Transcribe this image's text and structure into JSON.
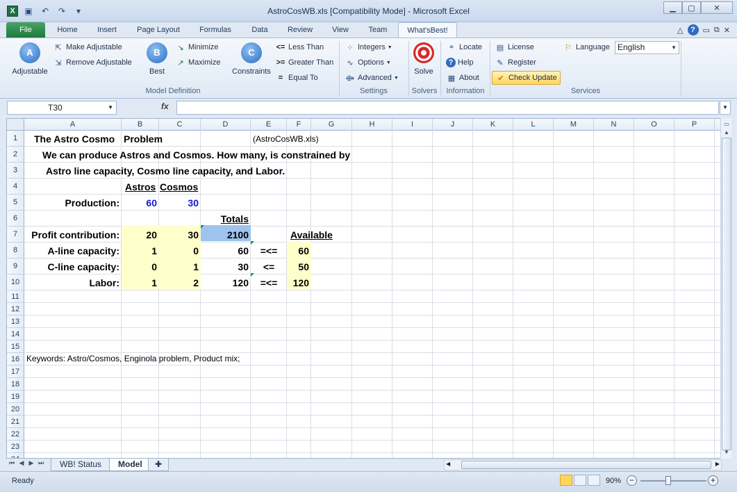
{
  "window": {
    "title": "AstroCosWB.xls  [Compatibility Mode]  -  Microsoft Excel",
    "app_icon": "X"
  },
  "ribbon_tabs": {
    "file": "File",
    "items": [
      "Home",
      "Insert",
      "Page Layout",
      "Formulas",
      "Data",
      "Review",
      "View",
      "Team",
      "What'sBest!"
    ]
  },
  "ribbon": {
    "adjustable": "Adjustable",
    "adjustable_icon_letter": "A",
    "make_adjustable": "Make Adjustable",
    "remove_adjustable": "Remove Adjustable",
    "best": "Best",
    "best_icon_letter": "B",
    "minimize": "Minimize",
    "maximize": "Maximize",
    "constraints": "Constraints",
    "constraints_icon_letter": "C",
    "less_than": "Less Than",
    "greater_than": "Greater Than",
    "equal_to": "Equal To",
    "integers": "Integers",
    "options": "Options",
    "advanced": "Advanced",
    "solve": "Solve",
    "locate": "Locate",
    "help": "Help",
    "about": "About",
    "license": "License",
    "register": "Register",
    "check_update": "Check Update",
    "language_label": "Language",
    "language_value": "English",
    "groups": {
      "model_definition": "Model Definition",
      "settings": "Settings",
      "solvers": "Solvers",
      "information": "Information",
      "services": "Services"
    }
  },
  "formula_bar": {
    "name_box": "T30",
    "fx": "fx",
    "formula": ""
  },
  "sheet": {
    "columns": [
      "A",
      "B",
      "C",
      "D",
      "E",
      "F",
      "G",
      "H",
      "I",
      "J",
      "K",
      "L",
      "M",
      "N",
      "O",
      "P"
    ],
    "rows": [
      "1",
      "2",
      "3",
      "4",
      "5",
      "6",
      "7",
      "8",
      "9",
      "10",
      "11",
      "12",
      "13",
      "14",
      "15",
      "16",
      "17",
      "18",
      "19",
      "20",
      "21",
      "22",
      "23",
      "24"
    ],
    "cells": {
      "A1": "The Astro Cosmo",
      "B1": "Problem",
      "E1": "(AstroCosWB.xls)",
      "A2": "We can produce Astros and Cosmos.  How many, is constrained by",
      "A3": "Astro line capacity, Cosmo line capacity, and Labor.",
      "B4": "Astros",
      "C4": "Cosmos",
      "A5": "Production:",
      "B5": "60",
      "C5": "30",
      "D6": "Totals",
      "A7": "Profit contribution:",
      "B7": "20",
      "C7": "30",
      "D7": "2100",
      "F7": "Available",
      "A8": "A-line capacity:",
      "B8": "1",
      "C8": "0",
      "D8": "60",
      "E8": "=<=",
      "F8": "60",
      "A9": "C-line capacity:",
      "B9": "0",
      "C9": "1",
      "D9": "30",
      "E9": "<=",
      "F9": "50",
      "A10": "Labor:",
      "B10": "1",
      "C10": "2",
      "D10": "120",
      "E10": "=<=",
      "F10": "120",
      "A16": "Keywords: Astro/Cosmos, Enginola problem, Product mix;"
    }
  },
  "sheet_tabs": [
    "WB! Status",
    "Model"
  ],
  "status_bar": {
    "status": "Ready",
    "zoom": "90%"
  },
  "colors": {
    "input_fill": "#ffffcc",
    "objective_fill": "#9dc3ee",
    "adjustable_text": "#1515d0",
    "file_tab": "#1d7a3b"
  }
}
